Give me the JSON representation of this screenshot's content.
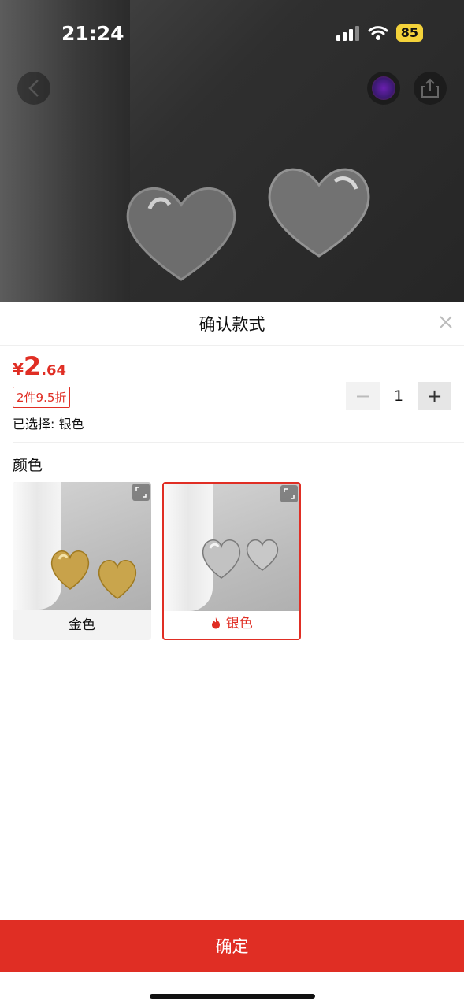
{
  "status_bar": {
    "time": "21:24",
    "battery": "85"
  },
  "sheet": {
    "title": "确认款式",
    "price": {
      "currency": "¥",
      "integer": "2",
      "decimal": ".64"
    },
    "promo": "2件9.5折",
    "selected_text": "已选择: 银色",
    "quantity": {
      "minus": "−",
      "value": "1",
      "plus": "+"
    },
    "section_label": "颜色",
    "options": [
      {
        "label": "金色",
        "selected": false
      },
      {
        "label": "银色",
        "selected": true
      }
    ],
    "confirm_label": "确定"
  },
  "colors": {
    "accent": "#e02e24"
  }
}
